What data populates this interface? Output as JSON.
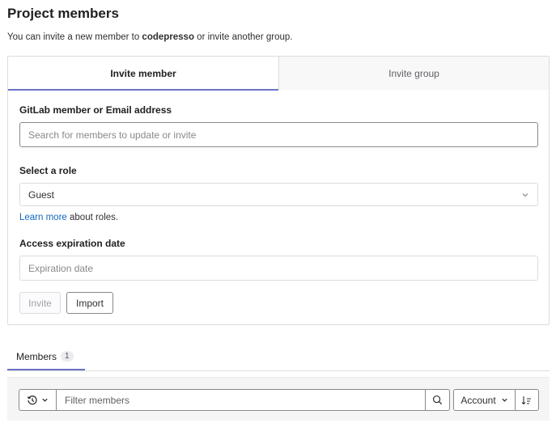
{
  "page": {
    "title": "Project members",
    "intro_before": "You can invite a new member to ",
    "intro_project": "codepresso",
    "intro_after": " or invite another group."
  },
  "tabs": {
    "invite_member": "Invite member",
    "invite_group": "Invite group"
  },
  "form": {
    "member_label": "GitLab member or Email address",
    "member_placeholder": "Search for members to update or invite",
    "role_label": "Select a role",
    "role_value": "Guest",
    "learn_more": "Learn more",
    "learn_more_suffix": " about roles.",
    "expiration_label": "Access expiration date",
    "expiration_placeholder": "Expiration date",
    "invite_button": "Invite",
    "import_button": "Import"
  },
  "members": {
    "tab_label": "Members",
    "count": "1",
    "filter_placeholder": "Filter members",
    "sort_value": "Account"
  },
  "icons": [
    "history-icon",
    "chevron-down-icon",
    "search-icon",
    "sort-direction-icon"
  ],
  "colors": {
    "accent": "#6e72c7",
    "link": "#1068bf"
  }
}
